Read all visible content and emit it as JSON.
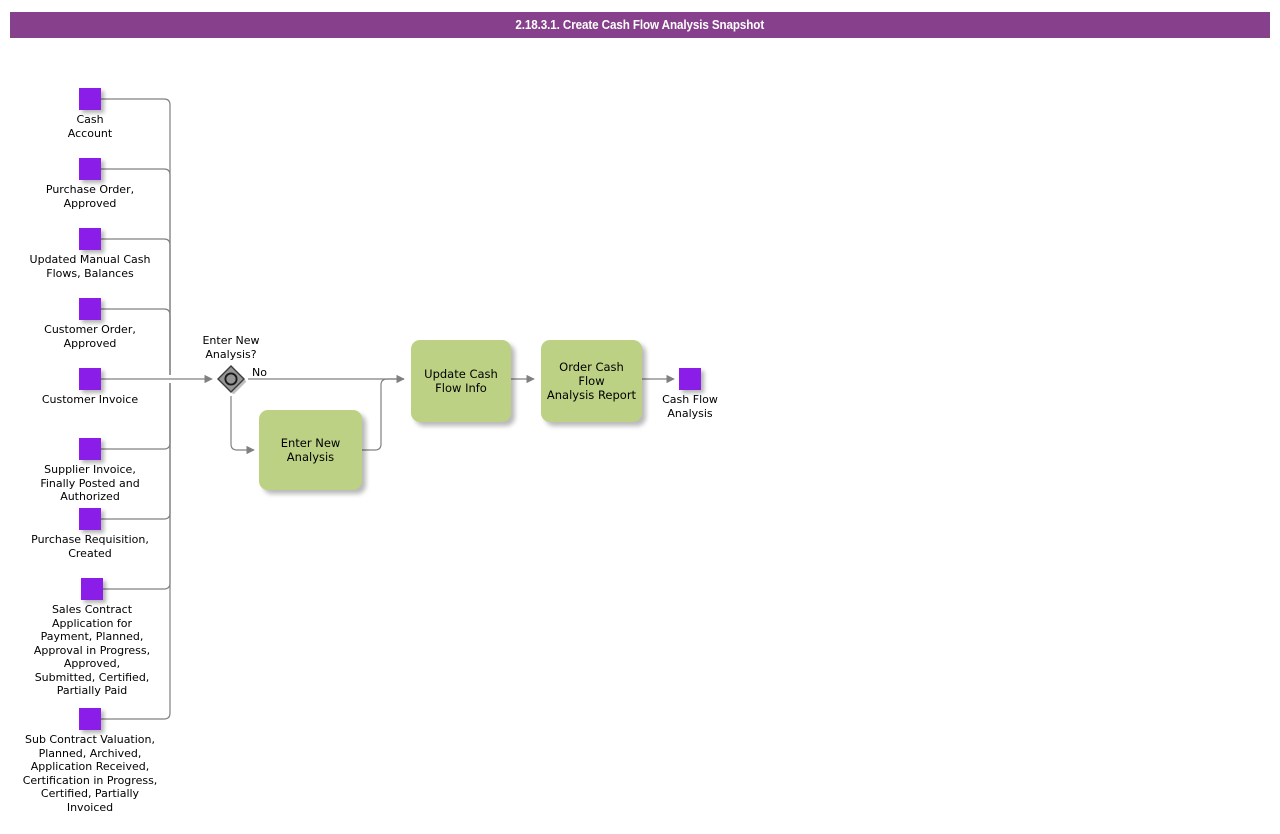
{
  "header": {
    "title": "2.18.3.1. Create Cash Flow Analysis Snapshot",
    "bar_color": "#86408c",
    "text_color": "#ffffff"
  },
  "palette": {
    "data_object": "#8a1ee8",
    "task": "#bcd184",
    "gateway_fill": "#969696",
    "gateway_border": "#3b3b3b",
    "connector": "#808080"
  },
  "diagram": {
    "type": "bpmn-process-flow",
    "inputs": [
      {
        "id": "cash-account",
        "label": "Cash\nAccount"
      },
      {
        "id": "purchase-order-approved",
        "label": "Purchase Order,\nApproved"
      },
      {
        "id": "updated-manual-cash-flows",
        "label": "Updated Manual Cash\nFlows, Balances"
      },
      {
        "id": "customer-order-approved",
        "label": "Customer Order,\nApproved"
      },
      {
        "id": "customer-invoice",
        "label": "Customer Invoice"
      },
      {
        "id": "supplier-invoice",
        "label": "Supplier Invoice,\nFinally Posted and\nAuthorized"
      },
      {
        "id": "purchase-requisition",
        "label": "Purchase Requisition,\nCreated"
      },
      {
        "id": "sales-contract-application",
        "label": "Sales Contract\nApplication for\nPayment, Planned,\nApproval in Progress,\nApproved,\nSubmitted, Certified,\nPartially Paid"
      },
      {
        "id": "sub-contract-valuation",
        "label": "Sub Contract Valuation,\nPlanned, Archived,\nApplication Received,\nCertification in Progress,\nCertified, Partially\nInvoiced"
      }
    ],
    "gateway": {
      "id": "enter-new-analysis-gateway",
      "label": "Enter New\nAnalysis?",
      "kind": "inclusive-gateway"
    },
    "edge_labels": [
      {
        "id": "no-branch",
        "text": "No"
      }
    ],
    "tasks": [
      {
        "id": "enter-new-analysis",
        "label": "Enter New\nAnalysis"
      },
      {
        "id": "update-cash-flow-info",
        "label": "Update Cash\nFlow Info"
      },
      {
        "id": "order-cash-flow-report",
        "label": "Order Cash Flow\nAnalysis Report"
      }
    ],
    "outputs": [
      {
        "id": "cash-flow-analysis",
        "label": "Cash Flow\nAnalysis"
      }
    ]
  }
}
